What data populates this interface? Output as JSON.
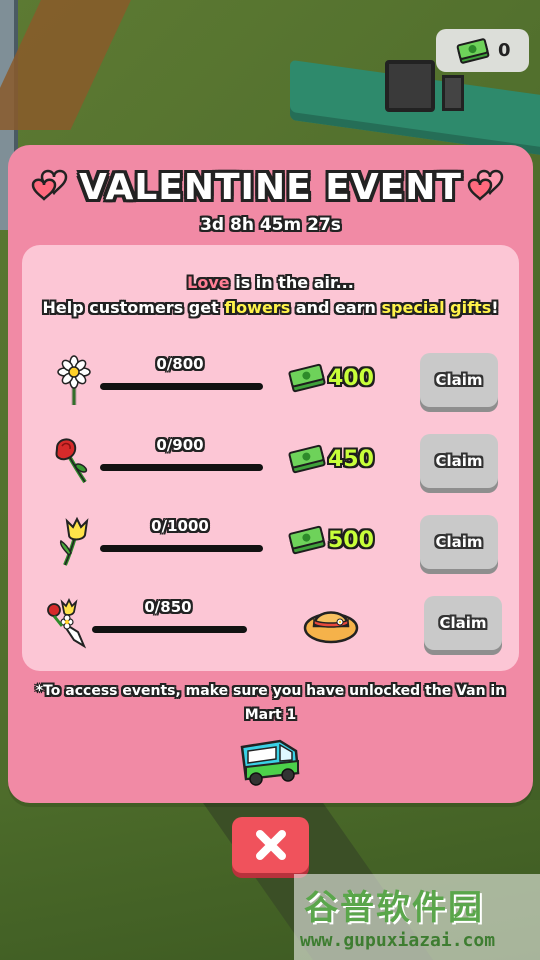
{
  "hud": {
    "currency_amount": "0"
  },
  "event": {
    "title": "VALENTINE EVENT",
    "timer": "3d 8h 45m 27s",
    "intro_love": "Love",
    "intro_rest": " is in the air...",
    "intro2_a": "Help customers get ",
    "intro2_flowers": "flowers",
    "intro2_b": " and earn ",
    "intro2_gifts": "special gifts",
    "intro2_c": "!",
    "rewards": [
      {
        "flower": "daisy-icon",
        "progress": "0/800",
        "progress_value": 0,
        "goal": 800,
        "reward": "400",
        "claim": "Claim"
      },
      {
        "flower": "rose-icon",
        "progress": "0/900",
        "progress_value": 0,
        "goal": 900,
        "reward": "450",
        "claim": "Claim"
      },
      {
        "flower": "tulip-icon",
        "progress": "0/1000",
        "progress_value": 0,
        "goal": 1000,
        "reward": "500",
        "claim": "Claim"
      },
      {
        "flower": "bouquet-icon",
        "progress": "0/850",
        "progress_value": 0,
        "goal": 850,
        "reward_item": "straw-hat-icon",
        "claim": "Claim"
      }
    ],
    "note": "*To access events, make sure you have unlocked the Van in Mart 1"
  },
  "watermark": {
    "title": "谷普软件园",
    "url": "www.gupuxiazai.com"
  },
  "colors": {
    "panel": "#f18aa5",
    "inner": "#fcc6d5",
    "reward_text": "#c8ff3a",
    "highlight_yellow": "#fff34a",
    "highlight_pink": "#ff7f95",
    "close_button": "#f0525c",
    "claim_button": "#c9c9c9"
  }
}
